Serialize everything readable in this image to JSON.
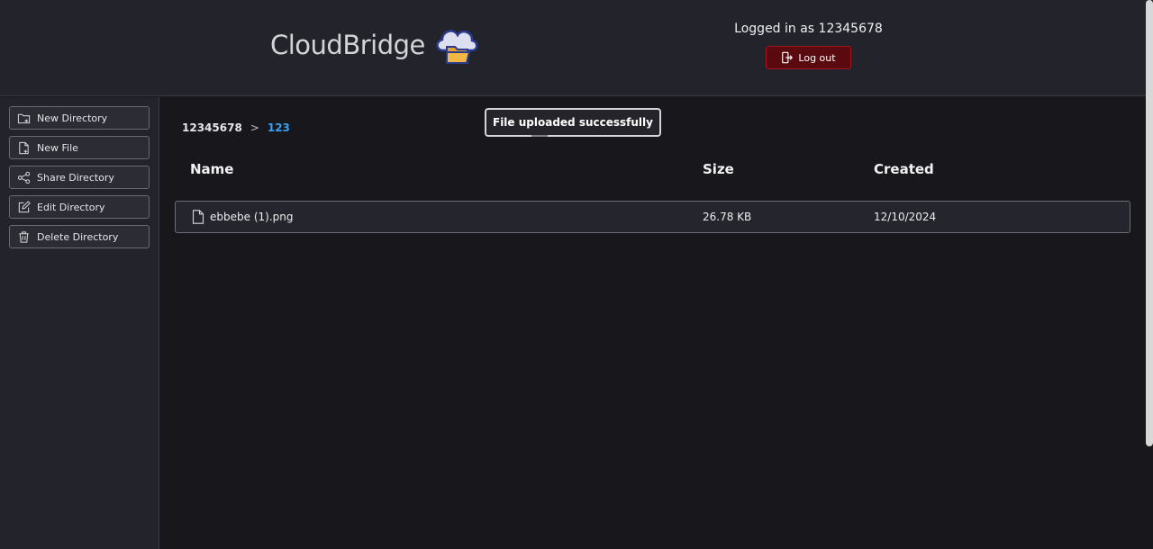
{
  "header": {
    "brand": "CloudBridge",
    "logo_icon": "cloud-folder-icon",
    "user_text": "Logged in as 12345678",
    "logout_label": "Log out",
    "logout_color": "#5a0a0e"
  },
  "sidebar": {
    "items": [
      {
        "label": "New Directory",
        "icon": "folder-plus-icon"
      },
      {
        "label": "New File",
        "icon": "file-plus-icon"
      },
      {
        "label": "Share Directory",
        "icon": "share-icon"
      },
      {
        "label": "Edit Directory",
        "icon": "edit-icon"
      },
      {
        "label": "Delete Directory",
        "icon": "trash-icon"
      }
    ]
  },
  "breadcrumb": {
    "root": "12345678",
    "separator": ">",
    "current": "123",
    "current_color": "#3a9ff0"
  },
  "toast": {
    "message": "File uploaded successfully"
  },
  "table": {
    "columns": [
      "Name",
      "Size",
      "Created"
    ],
    "rows": [
      {
        "name": "ebbebe (1).png",
        "size": "26.78 KB",
        "created": "12/10/2024",
        "icon": "file-icon"
      }
    ]
  }
}
